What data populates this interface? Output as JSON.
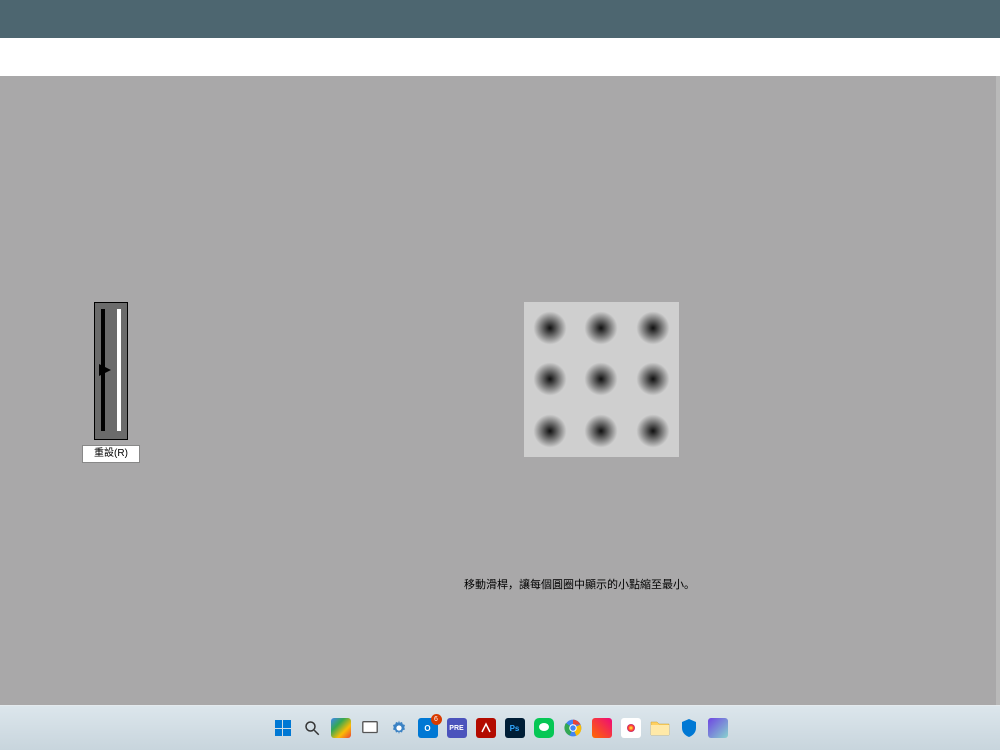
{
  "window": {
    "titlebar_color": "#4d6670"
  },
  "calibration": {
    "reset_label": "重設(R)",
    "instruction": "移動滑桿，讓每個圓圈中顯示的小點縮至最小。",
    "slider_value": 50
  },
  "taskbar": {
    "items": [
      {
        "name": "start",
        "badge": null
      },
      {
        "name": "search",
        "badge": null
      },
      {
        "name": "widgets",
        "badge": null
      },
      {
        "name": "task-view",
        "badge": null
      },
      {
        "name": "settings",
        "badge": null
      },
      {
        "name": "outlook",
        "badge": "6"
      },
      {
        "name": "teams",
        "badge": null
      },
      {
        "name": "adobe-reader",
        "badge": null
      },
      {
        "name": "photoshop",
        "badge": null
      },
      {
        "name": "line",
        "badge": null
      },
      {
        "name": "chrome",
        "badge": null
      },
      {
        "name": "paint3d",
        "badge": null
      },
      {
        "name": "davinci",
        "badge": null
      },
      {
        "name": "file-explorer",
        "badge": null
      },
      {
        "name": "security",
        "badge": null
      },
      {
        "name": "display-app",
        "badge": null
      }
    ]
  }
}
